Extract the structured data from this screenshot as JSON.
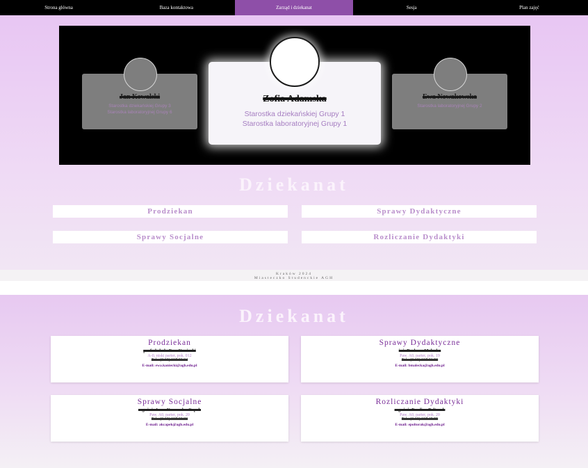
{
  "nav": {
    "items": [
      "Strona główna",
      "Baza kontaktowa",
      "Zarząd i dziekanat",
      "Sesja",
      "Plan zajęć"
    ],
    "active_index": 2
  },
  "carousel": {
    "left": {
      "name": "Jan Kowalski",
      "roles": [
        "Starostka dziekańskiej Grupy 3",
        "Starostka laboratoryjnej Grupy 6"
      ]
    },
    "center": {
      "name": "Zofia Adamska",
      "roles": [
        "Starostka dziekańskiej Grupy 1",
        "Starostka laboratoryjnej Grupy 1"
      ]
    },
    "right": {
      "name": "Ewa Nowakowska",
      "roles": [
        "Starostka laboratoryjnej Grupy 2"
      ]
    }
  },
  "section1": {
    "heading": "Dziekanat",
    "buttons": [
      "Prodziekan",
      "Sprawy Dydaktyczne",
      "Sprawy Socjalne",
      "Rozliczanie Dydaktyki"
    ]
  },
  "footer": {
    "line1": "Kraków 2024",
    "line2": "Miasteczko Studenckie AGH"
  },
  "section2": {
    "heading": "Dziekanat",
    "cards": [
      {
        "title": "Prodziekan",
        "person": "prof. dr hab. Ewa Kaniecki",
        "room": "A-0, niski parter, pok. 012",
        "phone": "Tel.: (0 12) 617 23 24",
        "email": "E-mail: ewa.kaniecki@agh.edu.pl"
      },
      {
        "title": "Sprawy Dydaktyczne",
        "person": "inż. Barbara Malecka",
        "room": "Paw. A0, parter, pok. 19",
        "phone": "Tel.: (0 12) 617 21 50",
        "email": "E-mail: bmalecka@agh.edu.pl"
      },
      {
        "title": "Sprawy Socjalne",
        "person": "mgr inż. Anna Kurowska-Capek",
        "room": "Paw. A0, parter, pok. 20",
        "phone": "Tel.: (0 12) 617 28 83",
        "email": "E-mail: akcapek@agh.edu.pl"
      },
      {
        "title": "Rozliczanie Dydaktyki",
        "person": "mgr inż. Ewelina Poltorak",
        "room": "Paw. A0, parter, pok. 20",
        "phone": "Tel.: (0 12) 617 45 55",
        "email": "E-mail: epoltorak@agh.edu.pl"
      }
    ]
  }
}
